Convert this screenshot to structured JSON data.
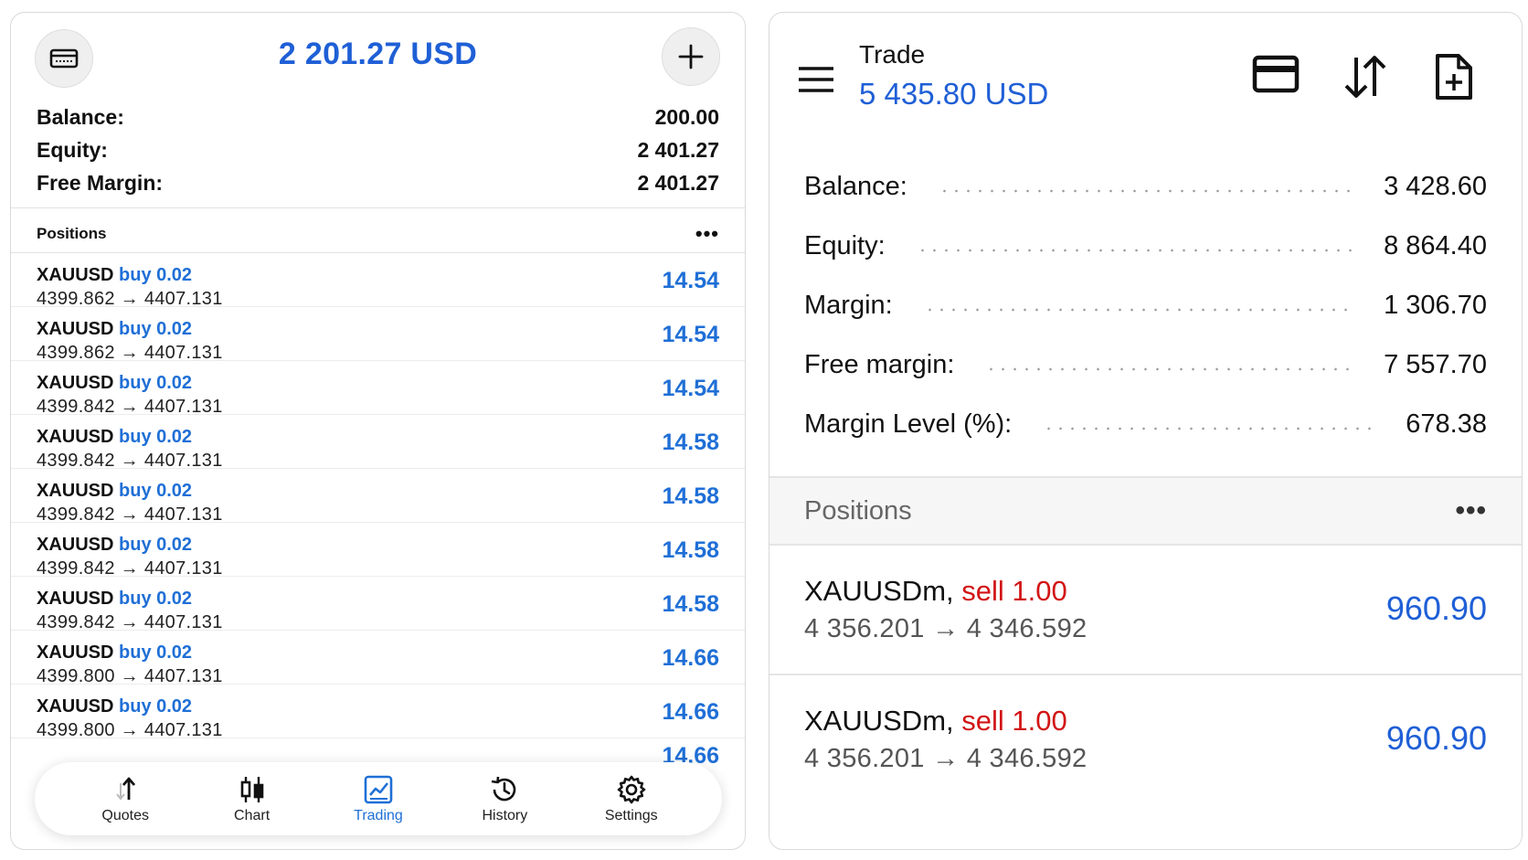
{
  "left": {
    "header": {
      "title": "2 201.27 USD"
    },
    "stats": [
      {
        "label": "Balance:",
        "value": "200.00"
      },
      {
        "label": "Equity:",
        "value": "2 401.27"
      },
      {
        "label": "Free Margin:",
        "value": "2 401.27"
      }
    ],
    "positions": {
      "title": "Positions",
      "more": "•••",
      "items": [
        {
          "symbol": "XAUUSD",
          "side": "buy 0.02",
          "prices": "4399.862 → 4407.131",
          "profit": "14.54"
        },
        {
          "symbol": "XAUUSD",
          "side": "buy 0.02",
          "prices": "4399.862 → 4407.131",
          "profit": "14.54"
        },
        {
          "symbol": "XAUUSD",
          "side": "buy 0.02",
          "prices": "4399.842 → 4407.131",
          "profit": "14.54"
        },
        {
          "symbol": "XAUUSD",
          "side": "buy 0.02",
          "prices": "4399.842 → 4407.131",
          "profit": "14.58"
        },
        {
          "symbol": "XAUUSD",
          "side": "buy 0.02",
          "prices": "4399.842 → 4407.131",
          "profit": "14.58"
        },
        {
          "symbol": "XAUUSD",
          "side": "buy 0.02",
          "prices": "4399.842 → 4407.131",
          "profit": "14.58"
        },
        {
          "symbol": "XAUUSD",
          "side": "buy 0.02",
          "prices": "4399.842 → 4407.131",
          "profit": "14.58"
        },
        {
          "symbol": "XAUUSD",
          "side": "buy 0.02",
          "prices": "4399.800 → 4407.131",
          "profit": "14.66"
        },
        {
          "symbol": "XAUUSD",
          "side": "buy 0.02",
          "prices": "4399.800 → 4407.131",
          "profit": "14.66"
        }
      ],
      "peek_profit": "14.66"
    },
    "tabs": [
      {
        "label": "Quotes",
        "icon": "quotes-icon"
      },
      {
        "label": "Chart",
        "icon": "candlestick-icon"
      },
      {
        "label": "Trading",
        "icon": "trading-chart-icon",
        "active": true
      },
      {
        "label": "History",
        "icon": "history-icon"
      },
      {
        "label": "Settings",
        "icon": "gear-icon"
      }
    ]
  },
  "right": {
    "header": {
      "title": "Trade",
      "balance": "5 435.80 USD"
    },
    "stats": [
      {
        "label": "Balance:",
        "value": "3 428.60"
      },
      {
        "label": "Equity:",
        "value": "8 864.40"
      },
      {
        "label": "Margin:",
        "value": "1 306.70"
      },
      {
        "label": "Free margin:",
        "value": "7 557.70"
      },
      {
        "label": "Margin Level (%):",
        "value": "678.38"
      }
    ],
    "positions": {
      "title": "Positions",
      "more": "•••",
      "items": [
        {
          "symbol": "XAUUSDm,",
          "side": "sell 1.00",
          "prices": "4 356.201 → 4 346.592",
          "profit": "960.90"
        },
        {
          "symbol": "XAUUSDm,",
          "side": "sell 1.00",
          "prices": "4 356.201 → 4 346.592",
          "profit": "960.90"
        }
      ]
    }
  },
  "colors": {
    "accent_blue": "#1f5fd6",
    "sell_red": "#d21414",
    "buy_blue": "#1f6fd6"
  }
}
